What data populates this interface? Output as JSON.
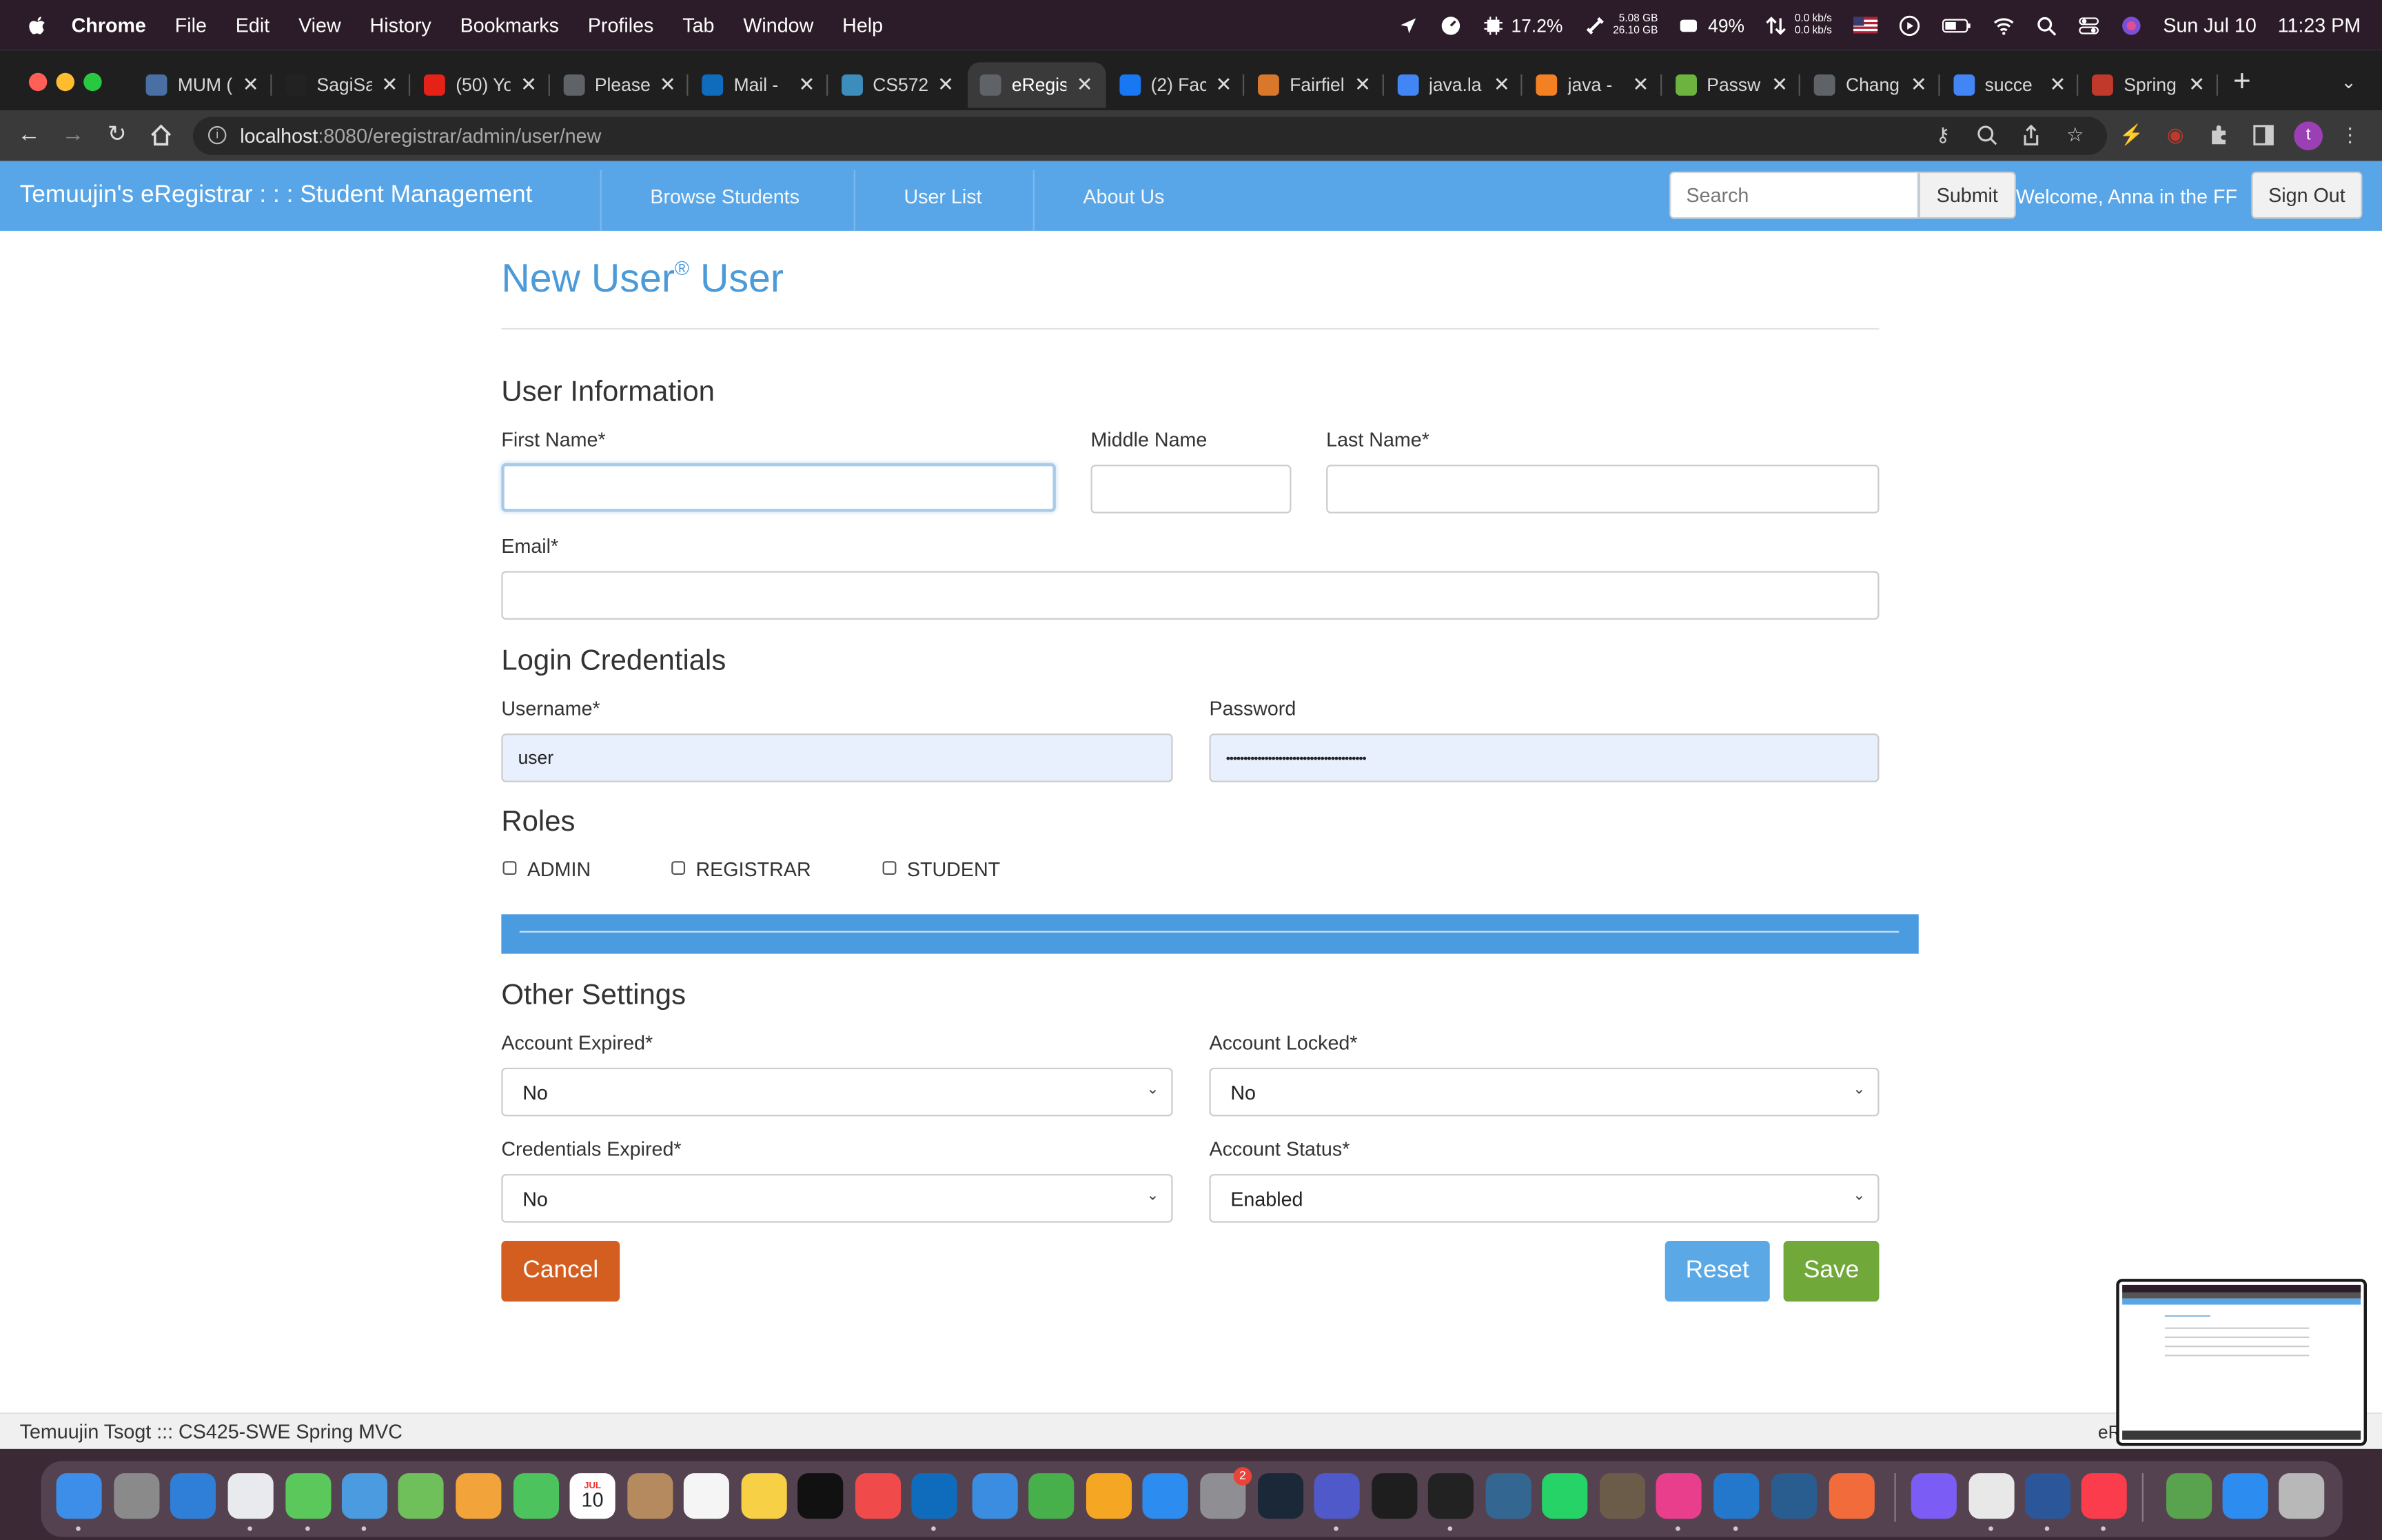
{
  "menubar": {
    "app": "Chrome",
    "menus": [
      "File",
      "Edit",
      "View",
      "History",
      "Bookmarks",
      "Profiles",
      "Tab",
      "Window",
      "Help"
    ],
    "cpu": "17.2%",
    "mem_top": "5.08 GB",
    "mem_bottom": "26.10 GB",
    "battery": "49%",
    "net_up": "0.0 kb/s",
    "net_down": "0.0 kb/s",
    "date": "Sun Jul 10",
    "time": "11:23 PM"
  },
  "tabs": [
    {
      "label": "MUM (",
      "color": "#4a6fa5"
    },
    {
      "label": "SagiSa",
      "color": "#222222"
    },
    {
      "label": "(50) Yo",
      "color": "#e62117"
    },
    {
      "label": "Please",
      "color": "#5f6368"
    },
    {
      "label": "Mail -",
      "color": "#0f6cbd"
    },
    {
      "label": "CS572",
      "color": "#3c8dbc"
    },
    {
      "label": "eRegis",
      "color": "#5f6368"
    },
    {
      "label": "(2) Fac",
      "color": "#1877f2"
    },
    {
      "label": "Fairfiel",
      "color": "#d9772b"
    },
    {
      "label": "java.la",
      "color": "#4285f4"
    },
    {
      "label": "java - ",
      "color": "#f48024"
    },
    {
      "label": "Passw",
      "color": "#6db33f"
    },
    {
      "label": "Chang",
      "color": "#5f6368"
    },
    {
      "label": "succe",
      "color": "#4285f4"
    },
    {
      "label": "Spring",
      "color": "#c0392b"
    }
  ],
  "address": {
    "host": "localhost",
    "path": ":8080/eregistrar/admin/user/new"
  },
  "appnav": {
    "brand": "Temuujin's eRegistrar : : : Student Management",
    "links": [
      "Browse Students",
      "User List",
      "About Us"
    ],
    "search_placeholder": "Search",
    "submit": "Submit",
    "welcome": "Welcome,  Anna in the FF",
    "signout": "Sign Out"
  },
  "form": {
    "title": "New User",
    "title_mark": "®",
    "title_suffix": " User",
    "user_info_heading": "User Information",
    "first_name_label": "First Name*",
    "first_name_value": "",
    "middle_name_label": "Middle Name",
    "middle_name_value": "",
    "last_name_label": "Last Name*",
    "last_name_value": "",
    "email_label": "Email*",
    "email_value": "",
    "login_heading": "Login Credentials",
    "username_label": "Username*",
    "username_value": "user",
    "password_label": "Password",
    "password_value": "••••••••••••••••••••••••••••••••••••••••",
    "roles_heading": "Roles",
    "roles": [
      "ADMIN",
      "REGISTRAR",
      "STUDENT"
    ],
    "other_heading": "Other Settings",
    "account_expired_label": "Account Expired*",
    "account_expired_value": "No",
    "account_locked_label": "Account Locked*",
    "account_locked_value": "No",
    "credentials_expired_label": "Credentials Expired*",
    "credentials_expired_value": "No",
    "account_status_label": "Account Status*",
    "account_status_value": "Enabled",
    "cancel": "Cancel",
    "reset": "Reset",
    "save": "Save"
  },
  "footer": {
    "left": "Temuujin Tsogt ::: CS425-SWE Spring MVC",
    "right": "eR"
  },
  "colors": {
    "navbar": "#58a6e7",
    "title": "#4c9bd9",
    "cancel": "#d35e1f",
    "reset": "#5aa9e6",
    "save": "#70a83a"
  },
  "dock": {
    "calendar_month": "JUL",
    "calendar_day": "10",
    "badge_count": "2"
  }
}
